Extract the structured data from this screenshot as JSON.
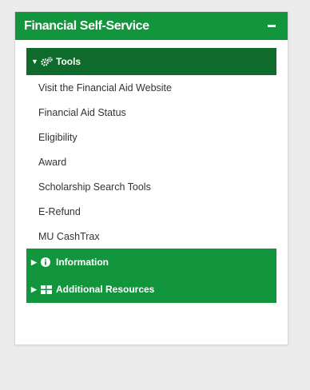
{
  "panel": {
    "title": "Financial Self-Service"
  },
  "sections": {
    "tools": {
      "label": "Tools",
      "links": [
        "Visit the Financial Aid Website",
        "Financial Aid Status",
        "Eligibility",
        "Award",
        "Scholarship Search Tools",
        "E-Refund",
        "MU CashTrax"
      ]
    },
    "information": {
      "label": "Information"
    },
    "additional_resources": {
      "label": "Additional Resources"
    }
  },
  "icons": {
    "collapse": "minus-icon",
    "expanded": "caret-down-icon",
    "collapsed": "caret-right-icon",
    "tools": "cogs-icon",
    "information": "info-circle-icon",
    "additional_resources": "th-large-icon"
  },
  "colors": {
    "header_green": "#12953d",
    "active_section_green": "#0f6b2c",
    "link_text": "#333333"
  }
}
